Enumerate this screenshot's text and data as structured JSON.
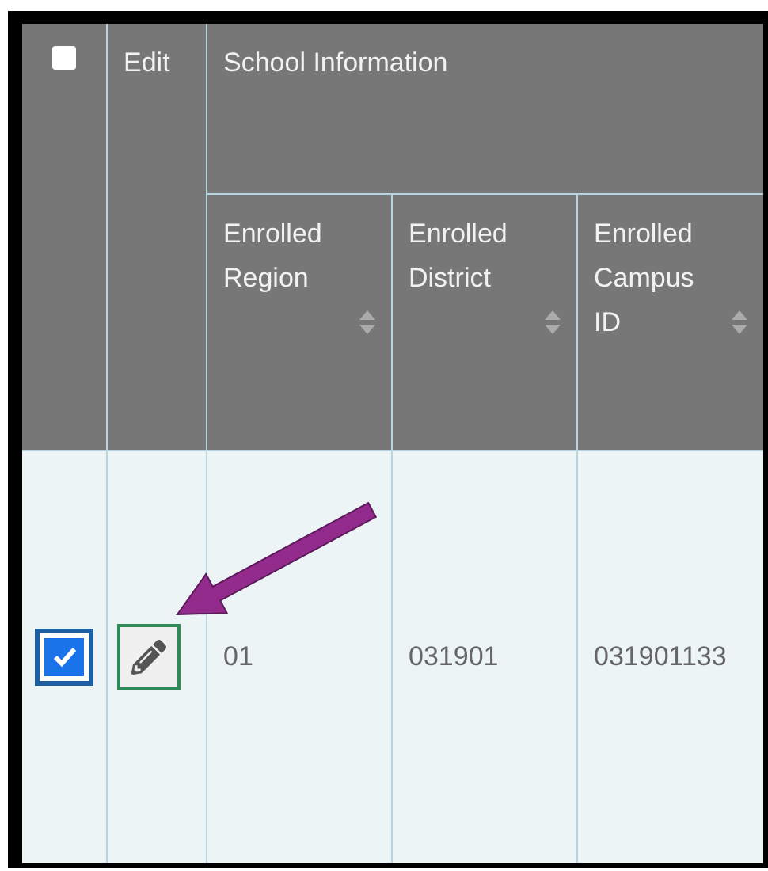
{
  "header": {
    "select_all": {
      "checked": false
    },
    "edit_label": "Edit",
    "group_label": "School Information",
    "columns": [
      {
        "label": "Enrolled\nRegion",
        "sortable": true
      },
      {
        "label": "Enrolled\nDistrict",
        "sortable": true
      },
      {
        "label": "Enrolled\nCampus\nID",
        "sortable": true
      }
    ]
  },
  "rows": [
    {
      "checked": true,
      "cells": [
        "01",
        "031901",
        "031901133"
      ]
    }
  ]
}
